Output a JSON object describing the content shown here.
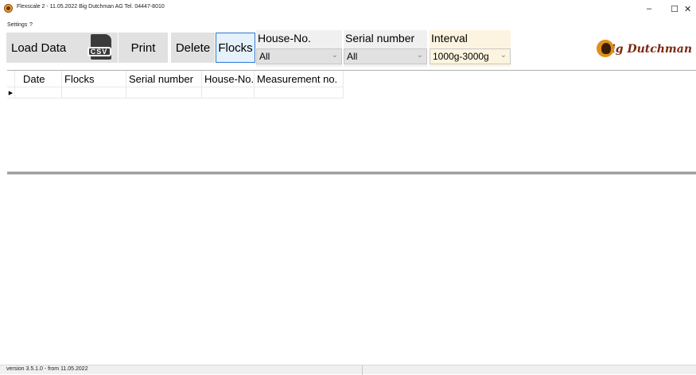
{
  "window": {
    "title": "Flexscale 2 - 11.05.2022 Big Dutchman AG  Tel. 04447-8010",
    "min_symbol": "–",
    "max_symbol": "☐",
    "close_symbol": "✕"
  },
  "menu": {
    "settings": "Settings",
    "help": "?"
  },
  "toolbar": {
    "load_data": "Load Data",
    "csv_icon_text": "CSV",
    "print": "Print",
    "delete": "Delete",
    "flocks": "Flocks"
  },
  "filters": {
    "house_label": "House-No.",
    "house_value": "All",
    "serial_label": "Serial number",
    "serial_value": "All",
    "interval_label": "Interval",
    "interval_value": "1000g-3000g",
    "chevron": "⌄"
  },
  "logo": {
    "text": "Big Dutchman"
  },
  "grid": {
    "columns": [
      "Date",
      "Flocks",
      "Serial number",
      "House-No.",
      "Measurement no."
    ],
    "row_indicator": "▶"
  },
  "status": {
    "version": "version 3.5.1.0 - from 11.05.2022"
  },
  "colors": {
    "button_bg": "#e1e1e1",
    "active_border": "#2b79d6",
    "interval_bg": "#fcf4e0",
    "logo_brown": "#7a2a12"
  },
  "icons": [
    "app-icon",
    "csv-file-icon",
    "chevron-down-icon",
    "row-pointer-icon",
    "big-dutchman-logo"
  ]
}
